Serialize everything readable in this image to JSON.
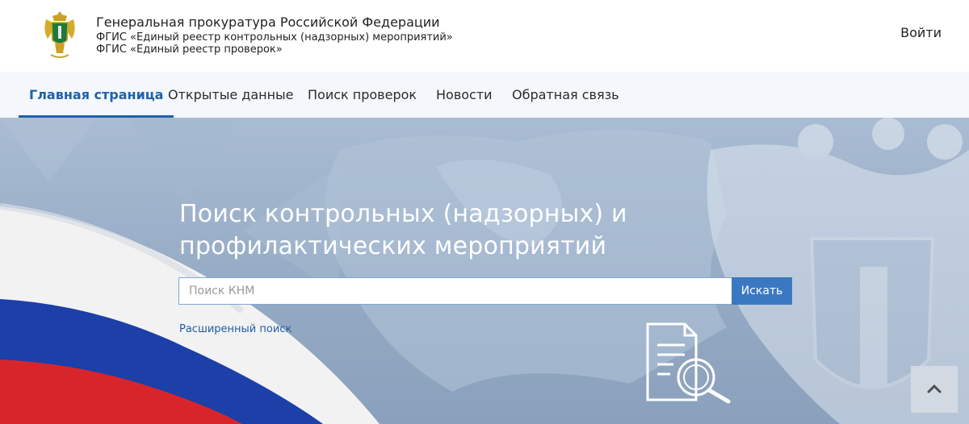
{
  "header": {
    "org_title": "Генеральная прокуратура Российской Федерации",
    "org_line2": "ФГИС «Единый реестр контрольных (надзорных) мероприятий»",
    "org_line3": "ФГИС «Единый реестр проверок»",
    "login_label": "Войти"
  },
  "nav": {
    "items": [
      {
        "label": "Главная страница",
        "active": true
      },
      {
        "label": "Открытые данные",
        "active": false
      },
      {
        "label": "Поиск проверок",
        "active": false
      },
      {
        "label": "Новости",
        "active": false
      },
      {
        "label": "Обратная связь",
        "active": false
      }
    ]
  },
  "hero": {
    "title_line1": "Поиск контрольных (надзорных) и",
    "title_line2": "профилактических мероприятий",
    "search_placeholder": "Поиск КНМ",
    "search_button": "Искать",
    "advanced_link": "Расширенный поиск"
  },
  "colors": {
    "accent": "#2061a8",
    "nav_bg": "#f4f7fb",
    "button": "#3b78c2",
    "flag_white": "#f2f2f2",
    "flag_blue": "#1c3fa8",
    "flag_red": "#d8252c"
  },
  "icons": {
    "emblem": "prosecutor-emblem-icon",
    "document_search": "document-search-icon",
    "scroll_top": "chevron-up-icon"
  }
}
